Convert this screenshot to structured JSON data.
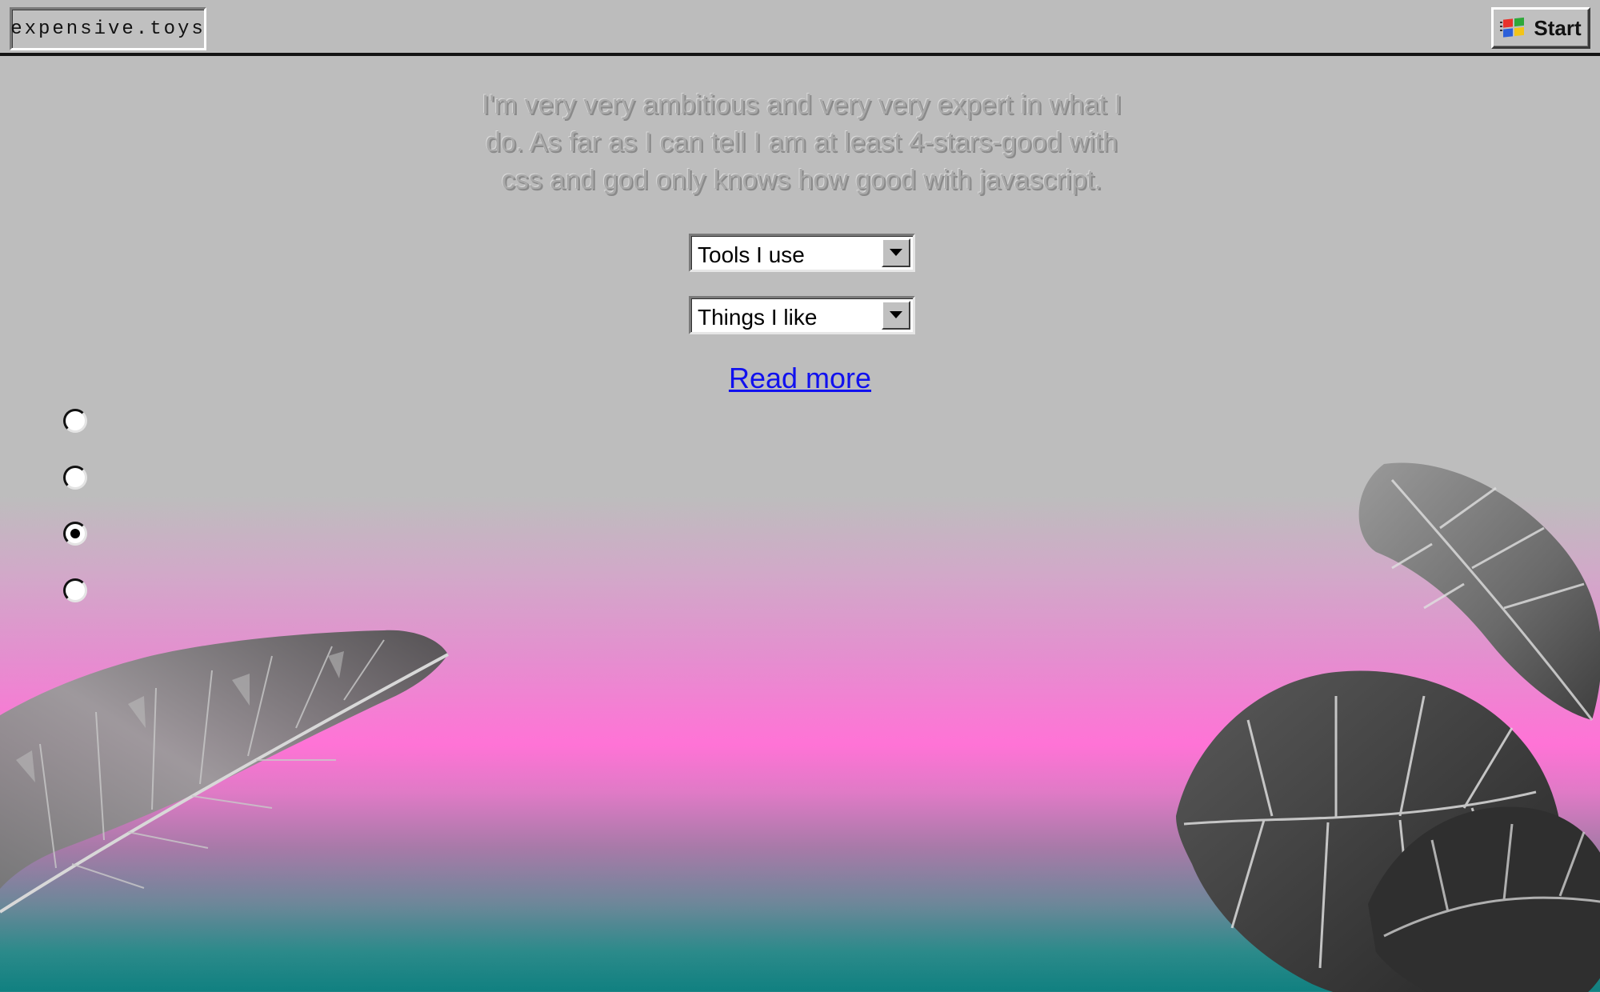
{
  "topbar": {
    "brand": "expensive.toys",
    "start_label": "Start"
  },
  "intro": {
    "text": "I'm very very ambitious and very very expert in what I do. As far as I can tell I am at least 4-stars-good with css and god only knows how good with javascript."
  },
  "selects": [
    {
      "value": "Tools I use"
    },
    {
      "value": "Things I like"
    }
  ],
  "read_more": "Read more",
  "radios": [
    {
      "checked": false
    },
    {
      "checked": false
    },
    {
      "checked": true
    },
    {
      "checked": false
    }
  ],
  "colors": {
    "bar_gray": "#bcbcbc",
    "gradient_pink": "#ff73d6",
    "gradient_teal": "#108080",
    "link_blue": "#1111ee"
  }
}
